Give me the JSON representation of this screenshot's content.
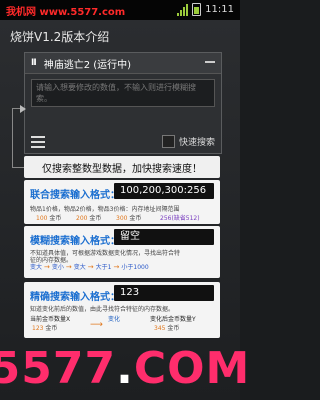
{
  "statusbar": {
    "site": "我机网 www.5577.com",
    "time": "11:11"
  },
  "app": {
    "title": "烧饼V1.2版本介绍"
  },
  "panel": {
    "pause_glyph": "II",
    "title": "神庙逃亡2 (运行中)",
    "input_placeholder": "请输入想要修改的数值，不输入则进行模糊搜索。",
    "quick_search_label": "快速搜索"
  },
  "tip": "仅搜索整数型数据，加快搜索速度！",
  "joint": {
    "title": "联合搜索输入格式：",
    "value": "100,200,300:256",
    "line1": "物品1价格，物品2价格，物品3价格：内存地址间隔范围",
    "items": [
      {
        "num": "100",
        "unit": "金币"
      },
      {
        "num": "200",
        "unit": "金币"
      },
      {
        "num": "300",
        "unit": "金币"
      }
    ],
    "range": "256(缺省512)"
  },
  "fuzzy": {
    "title": "模糊搜索输入格式：",
    "value": "留空",
    "line1": "不知道具体值，可根据游戏数据变化情况，寻找出符合特",
    "line2": "征的内存数据。",
    "chain": [
      "变大",
      "变小",
      "变大",
      "大于1",
      "小于1000"
    ]
  },
  "exact": {
    "title": "精确搜索输入格式：",
    "value": "123",
    "line1": "知道变化前后的数值，由此寻找符合特征的内存数据。",
    "current_label": "当前金币数量X",
    "current_num": "123",
    "current_unit": "金币",
    "change_label": "变化",
    "after_label": "变化后金币数量Y",
    "after_num": "345",
    "after_unit": "金币"
  },
  "footer": {
    "logo_main": "5577",
    "logo_dot": ".",
    "logo_tail": "COM"
  }
}
